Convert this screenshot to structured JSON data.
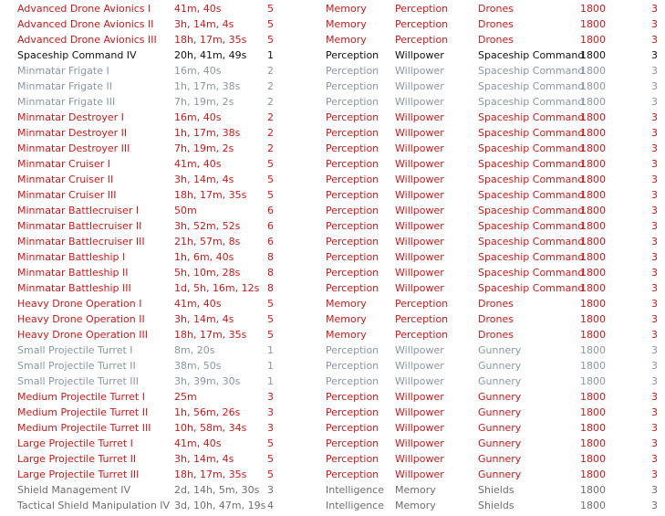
{
  "colors": {
    "missing": "#cc1a1a",
    "active": "#111111",
    "trained": "#8a96a6",
    "queued": "#6e6e6e"
  },
  "rows": [
    {
      "cells": [
        "Advanced Drone Avionics I",
        "41m, 40s",
        "5",
        "Memory",
        "Perception",
        "Drones",
        "1800",
        "3"
      ],
      "status": "missing"
    },
    {
      "cells": [
        "Advanced Drone Avionics II",
        "3h, 14m, 4s",
        "5",
        "Memory",
        "Perception",
        "Drones",
        "1800",
        "3"
      ],
      "status": "missing"
    },
    {
      "cells": [
        "Advanced Drone Avionics III",
        "18h, 17m, 35s",
        "5",
        "Memory",
        "Perception",
        "Drones",
        "1800",
        "3"
      ],
      "status": "missing"
    },
    {
      "cells": [
        "Spaceship Command IV",
        "20h, 41m, 49s",
        "1",
        "Perception",
        "Willpower",
        "Spaceship Command",
        "1800",
        "3"
      ],
      "status": "active"
    },
    {
      "cells": [
        "Minmatar Frigate I",
        "16m, 40s",
        "2",
        "Perception",
        "Willpower",
        "Spaceship Command",
        "1800",
        "3"
      ],
      "status": "trained"
    },
    {
      "cells": [
        "Minmatar Frigate II",
        "1h, 17m, 38s",
        "2",
        "Perception",
        "Willpower",
        "Spaceship Command",
        "1800",
        "3"
      ],
      "status": "trained"
    },
    {
      "cells": [
        "Minmatar Frigate III",
        "7h, 19m, 2s",
        "2",
        "Perception",
        "Willpower",
        "Spaceship Command",
        "1800",
        "3"
      ],
      "status": "trained"
    },
    {
      "cells": [
        "Minmatar Destroyer I",
        "16m, 40s",
        "2",
        "Perception",
        "Willpower",
        "Spaceship Command",
        "1800",
        "3"
      ],
      "status": "missing"
    },
    {
      "cells": [
        "Minmatar Destroyer II",
        "1h, 17m, 38s",
        "2",
        "Perception",
        "Willpower",
        "Spaceship Command",
        "1800",
        "3"
      ],
      "status": "missing"
    },
    {
      "cells": [
        "Minmatar Destroyer III",
        "7h, 19m, 2s",
        "2",
        "Perception",
        "Willpower",
        "Spaceship Command",
        "1800",
        "3"
      ],
      "status": "missing"
    },
    {
      "cells": [
        "Minmatar Cruiser I",
        "41m, 40s",
        "5",
        "Perception",
        "Willpower",
        "Spaceship Command",
        "1800",
        "3"
      ],
      "status": "missing"
    },
    {
      "cells": [
        "Minmatar Cruiser II",
        "3h, 14m, 4s",
        "5",
        "Perception",
        "Willpower",
        "Spaceship Command",
        "1800",
        "3"
      ],
      "status": "missing"
    },
    {
      "cells": [
        "Minmatar Cruiser III",
        "18h, 17m, 35s",
        "5",
        "Perception",
        "Willpower",
        "Spaceship Command",
        "1800",
        "3"
      ],
      "status": "missing"
    },
    {
      "cells": [
        "Minmatar Battlecruiser I",
        "50m",
        "6",
        "Perception",
        "Willpower",
        "Spaceship Command",
        "1800",
        "3"
      ],
      "status": "missing"
    },
    {
      "cells": [
        "Minmatar Battlecruiser II",
        "3h, 52m, 52s",
        "6",
        "Perception",
        "Willpower",
        "Spaceship Command",
        "1800",
        "3"
      ],
      "status": "missing"
    },
    {
      "cells": [
        "Minmatar Battlecruiser III",
        "21h, 57m, 8s",
        "6",
        "Perception",
        "Willpower",
        "Spaceship Command",
        "1800",
        "3"
      ],
      "status": "missing"
    },
    {
      "cells": [
        "Minmatar Battleship I",
        "1h, 6m, 40s",
        "8",
        "Perception",
        "Willpower",
        "Spaceship Command",
        "1800",
        "3"
      ],
      "status": "missing"
    },
    {
      "cells": [
        "Minmatar Battleship II",
        "5h, 10m, 28s",
        "8",
        "Perception",
        "Willpower",
        "Spaceship Command",
        "1800",
        "3"
      ],
      "status": "missing"
    },
    {
      "cells": [
        "Minmatar Battleship III",
        "1d, 5h, 16m, 12s",
        "8",
        "Perception",
        "Willpower",
        "Spaceship Command",
        "1800",
        "3"
      ],
      "status": "missing"
    },
    {
      "cells": [
        "Heavy Drone Operation I",
        "41m, 40s",
        "5",
        "Memory",
        "Perception",
        "Drones",
        "1800",
        "3"
      ],
      "status": "missing"
    },
    {
      "cells": [
        "Heavy Drone Operation II",
        "3h, 14m, 4s",
        "5",
        "Memory",
        "Perception",
        "Drones",
        "1800",
        "3"
      ],
      "status": "missing"
    },
    {
      "cells": [
        "Heavy Drone Operation III",
        "18h, 17m, 35s",
        "5",
        "Memory",
        "Perception",
        "Drones",
        "1800",
        "3"
      ],
      "status": "missing"
    },
    {
      "cells": [
        "Small Projectile Turret I",
        "8m, 20s",
        "1",
        "Perception",
        "Willpower",
        "Gunnery",
        "1800",
        "3"
      ],
      "status": "trained"
    },
    {
      "cells": [
        "Small Projectile Turret II",
        "38m, 50s",
        "1",
        "Perception",
        "Willpower",
        "Gunnery",
        "1800",
        "3"
      ],
      "status": "trained"
    },
    {
      "cells": [
        "Small Projectile Turret III",
        "3h, 39m, 30s",
        "1",
        "Perception",
        "Willpower",
        "Gunnery",
        "1800",
        "3"
      ],
      "status": "trained"
    },
    {
      "cells": [
        "Medium Projectile Turret I",
        "25m",
        "3",
        "Perception",
        "Willpower",
        "Gunnery",
        "1800",
        "3"
      ],
      "status": "missing"
    },
    {
      "cells": [
        "Medium Projectile Turret II",
        "1h, 56m, 26s",
        "3",
        "Perception",
        "Willpower",
        "Gunnery",
        "1800",
        "3"
      ],
      "status": "missing"
    },
    {
      "cells": [
        "Medium Projectile Turret III",
        "10h, 58m, 34s",
        "3",
        "Perception",
        "Willpower",
        "Gunnery",
        "1800",
        "3"
      ],
      "status": "missing"
    },
    {
      "cells": [
        "Large Projectile Turret I",
        "41m, 40s",
        "5",
        "Perception",
        "Willpower",
        "Gunnery",
        "1800",
        "3"
      ],
      "status": "missing"
    },
    {
      "cells": [
        "Large Projectile Turret II",
        "3h, 14m, 4s",
        "5",
        "Perception",
        "Willpower",
        "Gunnery",
        "1800",
        "3"
      ],
      "status": "missing"
    },
    {
      "cells": [
        "Large Projectile Turret III",
        "18h, 17m, 35s",
        "5",
        "Perception",
        "Willpower",
        "Gunnery",
        "1800",
        "3"
      ],
      "status": "missing"
    },
    {
      "cells": [
        "Shield Management IV",
        "2d, 14h, 5m, 30s",
        "3",
        "Intelligence",
        "Memory",
        "Shields",
        "1800",
        "3"
      ],
      "status": "queued"
    },
    {
      "cells": [
        "Tactical Shield Manipulation IV",
        "3d, 10h, 47m, 19s",
        "4",
        "Intelligence",
        "Memory",
        "Shields",
        "1800",
        "3"
      ],
      "status": "queued"
    }
  ]
}
